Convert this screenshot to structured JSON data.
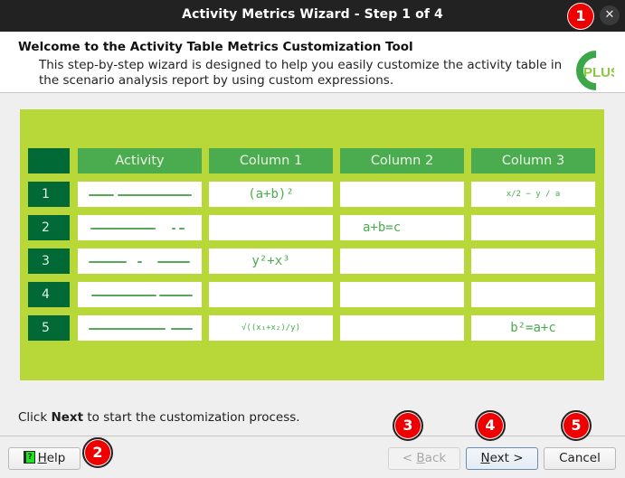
{
  "window": {
    "title": "Activity Metrics Wizard - Step 1 of 4",
    "close_icon": "close-icon"
  },
  "header": {
    "title": "Welcome to the Activity Table Metrics Customization Tool",
    "subtitle": "This step-by-step wizard is designed to help you easily customize the activity table in the scenario analysis report by using custom expressions.",
    "logo_text": "PLUS"
  },
  "illustration": {
    "colors": {
      "background": "#b8d738",
      "dark_green": "#006935",
      "header_green": "#4aab4f",
      "ink_green": "#4aab4f"
    },
    "columns": [
      "Activity",
      "Column 1",
      "Column 2",
      "Column 3"
    ],
    "rows": [
      {
        "num": "1",
        "col1": "(a+b)²",
        "col2": "",
        "col3": "x/2 − y / a"
      },
      {
        "num": "2",
        "col1": "",
        "col2": "a+b=c",
        "col3": ""
      },
      {
        "num": "3",
        "col1": "y²+x³",
        "col2": "",
        "col3": ""
      },
      {
        "num": "4",
        "col1": "",
        "col2": "",
        "col3": ""
      },
      {
        "num": "5",
        "col1": "√((x₁+x₂)/y)",
        "col2": "",
        "col3": "b²=a+c"
      }
    ]
  },
  "footer": {
    "instruction_prefix": "Click ",
    "instruction_bold": "Next",
    "instruction_suffix": " to start the customization process."
  },
  "buttons": {
    "help": {
      "icon": "help-book-icon",
      "mnemonic": "H",
      "rest": "elp",
      "enabled": true
    },
    "back": {
      "prefix": "< ",
      "mnemonic": "B",
      "rest": "ack",
      "enabled": false
    },
    "next": {
      "mnemonic": "N",
      "rest": "ext >",
      "enabled": true,
      "default": true
    },
    "cancel": {
      "label": "Cancel",
      "enabled": true
    }
  },
  "badges": [
    "1",
    "2",
    "3",
    "4",
    "5"
  ]
}
